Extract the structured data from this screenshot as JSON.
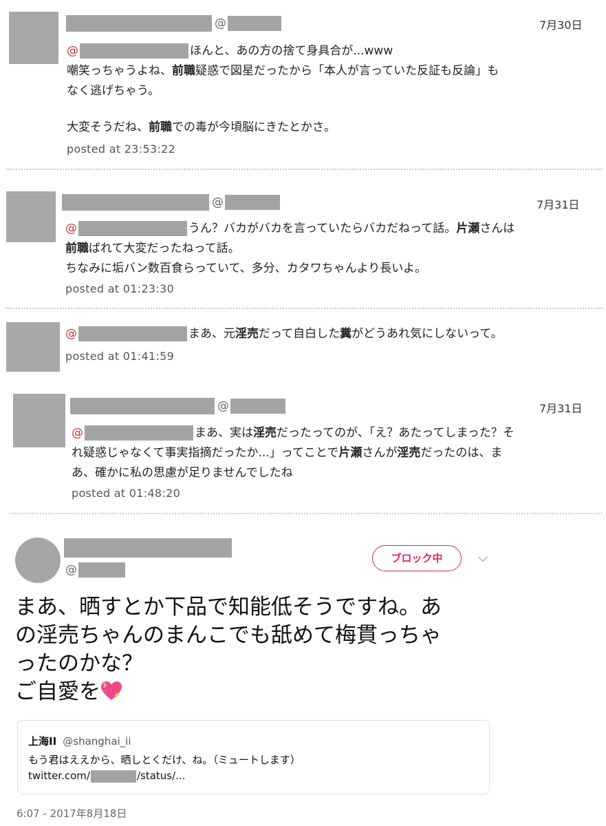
{
  "tweets": [
    {
      "date": "7月30日",
      "at": "@",
      "text_html": "ほんと、あの方の捨て身具合が...www",
      "line2": [
        "嘲笑っちゃうよね、",
        "前職",
        "疑惑で図星だったから「本人が言っていた反証も反論」も"
      ],
      "line3": "なく逃げちゃう。",
      "line4": [
        "大変そうだね、",
        "前職",
        "での毒が今頃脳にきたとかさ。"
      ],
      "posted": "posted at 23:53:22"
    },
    {
      "date": "7月31日",
      "at": "@",
      "line1": [
        "うん？バカがバカを言っていたらバカだねって話。",
        "片瀬",
        "さんは"
      ],
      "line2": [
        "前職",
        "ばれて大変だったねって話。"
      ],
      "line3": "ちなみに垢バン数百食らっていて、多分、カタワちゃんより長いよ。",
      "posted": "posted at 01:23:30"
    },
    {
      "at": "@",
      "line1": [
        "まあ、元",
        "淫売",
        "だって自白した",
        "糞",
        "がどうあれ気にしないって。"
      ],
      "posted": "posted at 01:41:59"
    },
    {
      "date": "7月31日",
      "at": "@",
      "line1": [
        "まあ、実は",
        "淫売",
        "だったってのが、「え？あたってしまった？そ"
      ],
      "line2": [
        "れ疑惑じゃなくて事実指摘だったか...」ってことで",
        "片瀬",
        "さんが",
        "淫売",
        "だったのは、ま"
      ],
      "line3": "あ、確かに私の思慮が足りませんでしたね",
      "posted": "posted at 01:48:20"
    }
  ],
  "main_tweet": {
    "handle_at": "@",
    "block_label": "ブロック中",
    "text_lines": [
      "まあ、晒すとか下品で知能低そうですね。あ",
      "の淫売ちゃんのまんこでも舐めて梅貫っちゃ",
      "ったのかな？",
      "ご自愛を"
    ],
    "emoji": "sparkling-heart-icon",
    "quote": {
      "name": "上海II",
      "handle": "@shanghai_ii",
      "text": "もう君はええから、晒しとくだけ、ね。（ミュートします）",
      "link_prefix": "twitter.com/",
      "link_suffix": "/status/..."
    },
    "timestamp": "6:07 - 2017年8月18日"
  },
  "colors": {
    "at_red": "#cc3333",
    "block_pink": "#e0245e",
    "redaction_gray": "#a3a3a3"
  }
}
